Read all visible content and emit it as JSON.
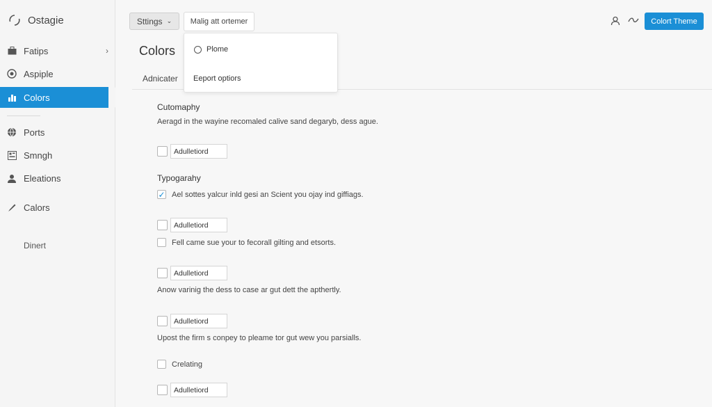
{
  "app": {
    "title": "Ostagie"
  },
  "sidebar": {
    "items": [
      {
        "label": "Fatips",
        "icon": "briefcase-icon"
      },
      {
        "label": "Aspiple",
        "icon": "target-icon"
      },
      {
        "label": "Colors",
        "icon": "bar-chart-icon",
        "active": true
      },
      {
        "label": "Ports",
        "icon": "globe-icon"
      },
      {
        "label": "Smngh",
        "icon": "layout-icon"
      },
      {
        "label": "Eleations",
        "icon": "users-icon"
      },
      {
        "label": "Calors",
        "icon": "pen-icon"
      }
    ],
    "footer_label": "Dinert"
  },
  "toolbar": {
    "settings_label": "Sttings",
    "dropdown_label": "Malig att ortemer",
    "theme_button": "Colort Theme"
  },
  "menu": {
    "items": [
      {
        "label": "Plome",
        "icon": "radio-icon"
      },
      {
        "label": "Eeport optiors"
      }
    ]
  },
  "main": {
    "title": "Colors",
    "tab": "Adnicater",
    "sections": {
      "customization": {
        "heading": "Cutomaphy",
        "description": "Aeragd in the wayine recomaled calive sand degaryb, dess ague.",
        "field": "Adulletiord"
      },
      "typography": {
        "heading": "Typogarahy",
        "checked_option": "Ael sottes yalcur inld gesi an Scient you ojay ind giffiags.",
        "field1": "Adulletiord",
        "option2": "Fell came sue your to fecorall gilting and etsorts.",
        "field2": "Adulletiord",
        "desc2": "Anow varinig the dess to case ar gut dett the  apthertly.",
        "field3": "Adulletiord",
        "desc3": "Upost the firm s conpey to pleame tor gut wew you parsialls.",
        "option3": "Crelating",
        "field4": "Adulletiord"
      }
    }
  },
  "colors": {
    "accent": "#1b8fd6"
  }
}
